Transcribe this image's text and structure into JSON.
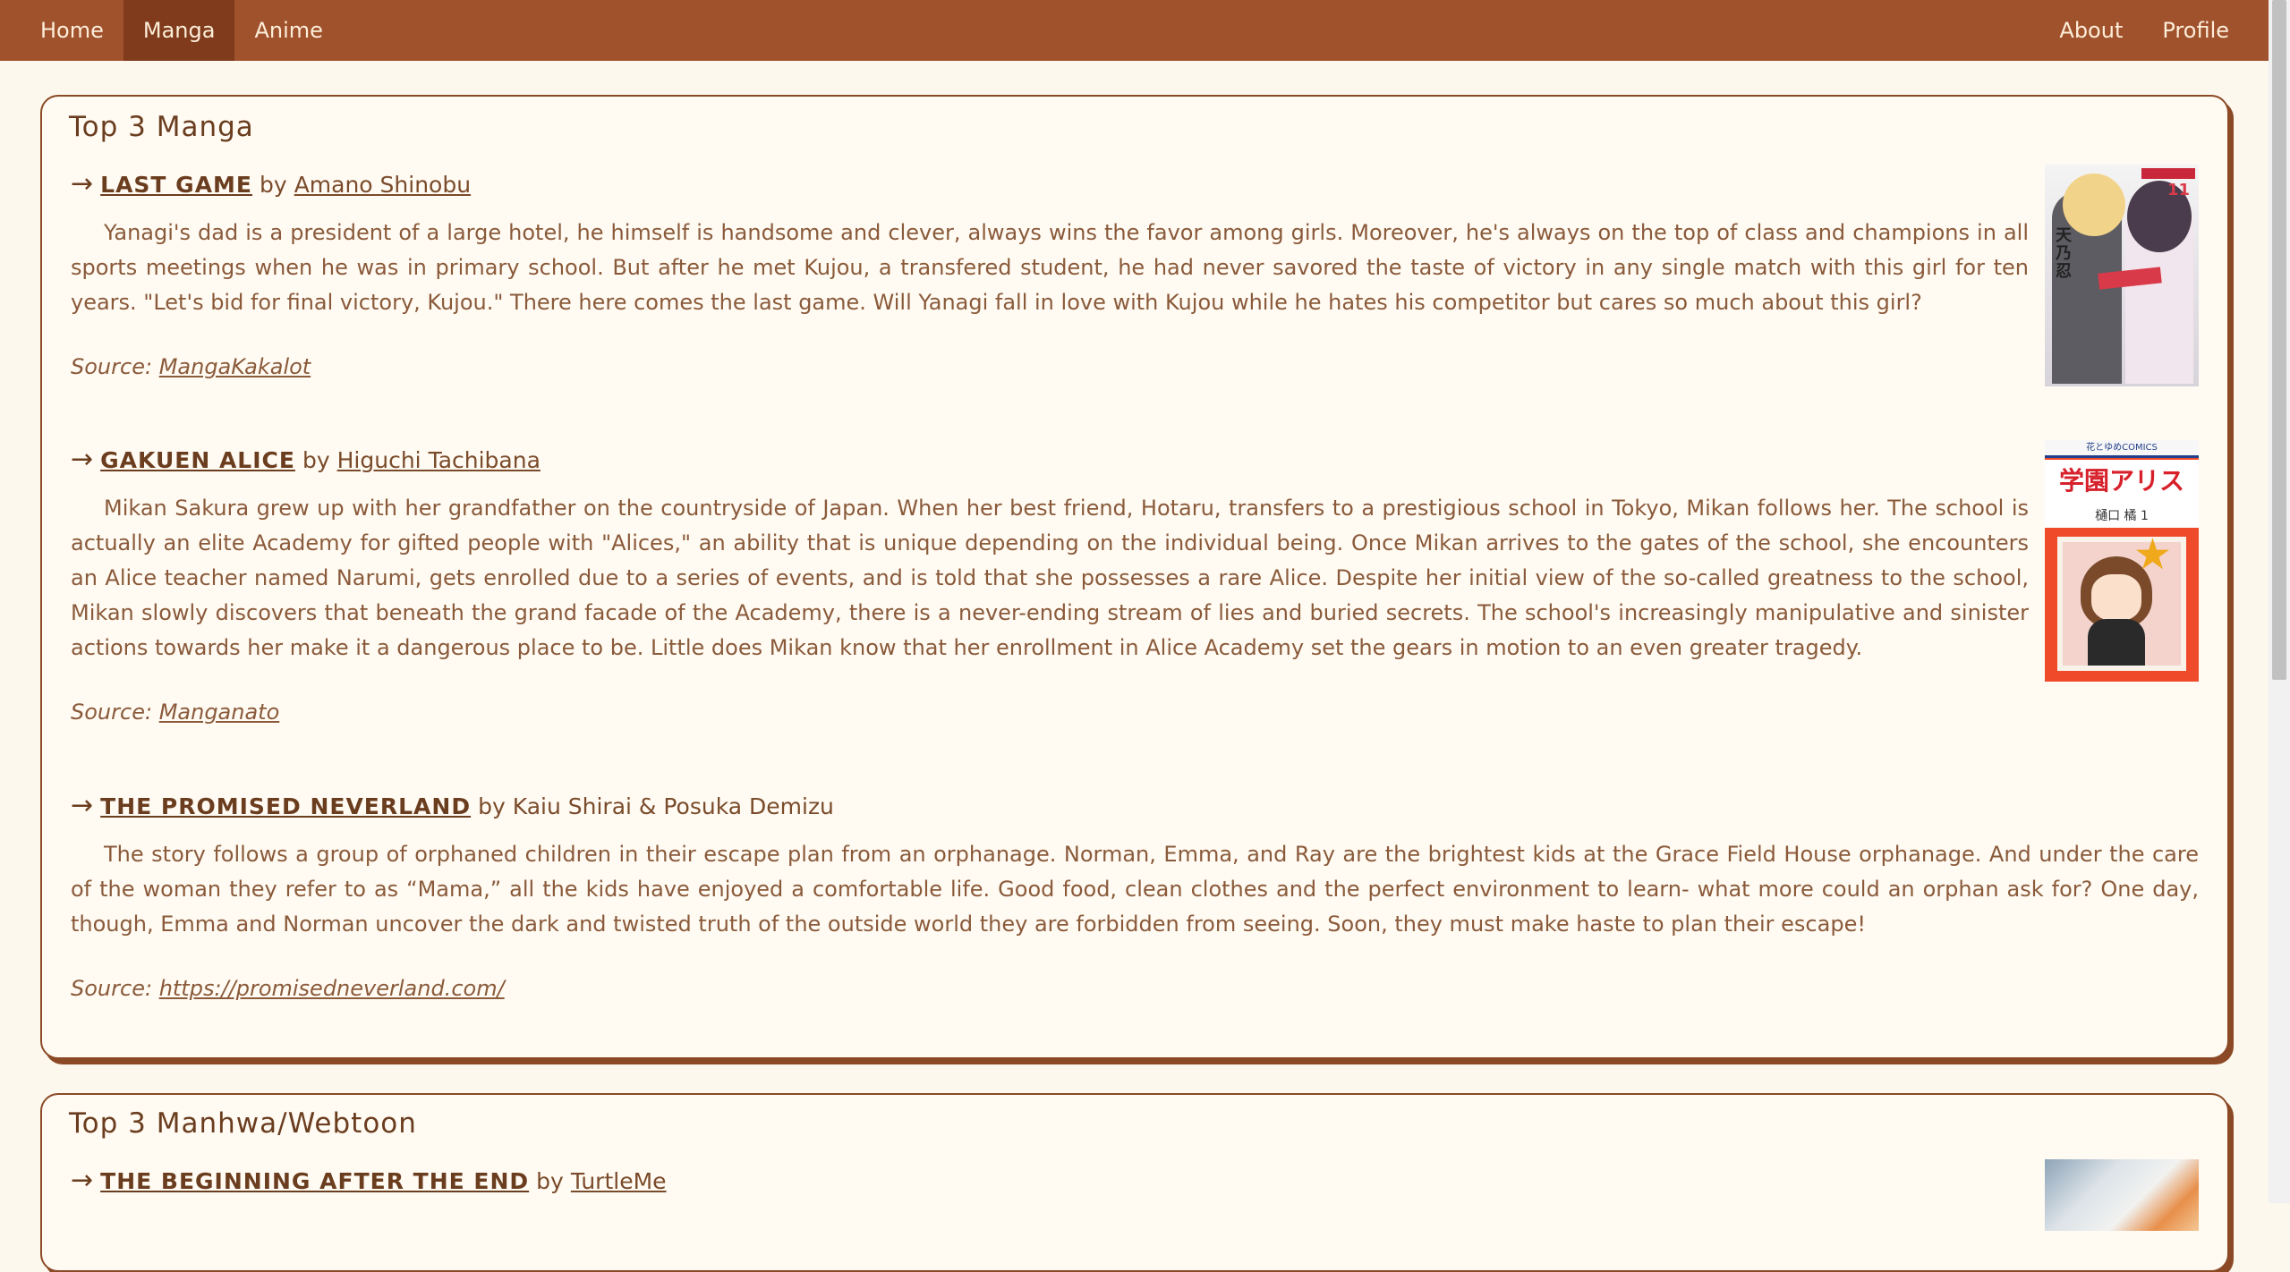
{
  "nav": {
    "left": [
      "Home",
      "Manga",
      "Anime"
    ],
    "active": "Manga",
    "right": [
      "About",
      "Profile"
    ]
  },
  "sections": [
    {
      "heading": "Top 3 Manga",
      "entries": [
        {
          "arrow": "→",
          "title": "LAST GAME",
          "by": "by",
          "author": "Amano Shinobu",
          "description": "Yanagi's dad is a president of a large hotel, he himself is handsome and clever, always wins the favor among girls. Moreover, he's always on the top of class and champions in all sports meetings when he was in primary school. But after he met Kujou, a transfered student, he had never savored the taste of victory in any single match with this girl for ten years. \"Let's bid for final victory, Kujou.\" There here comes the last game. Will Yanagi fall in love with Kujou while he hates his competitor but cares so much about this girl?",
          "source_label": "Source:",
          "source": "MangaKakalot",
          "cover": {
            "text": "天乃忍",
            "num": "11"
          }
        },
        {
          "arrow": "→",
          "title": "GAKUEN ALICE",
          "by": "by",
          "author": "Higuchi Tachibana",
          "description": "Mikan Sakura grew up with her grandfather on the countryside of Japan. When her best friend, Hotaru, transfers to a prestigious school in Tokyo, Mikan follows her. The school is actually an elite Academy for gifted people with \"Alices,\" an ability that is unique depending on the individual being. Once Mikan arrives to the gates of the school, she encounters an Alice teacher named Narumi, gets enrolled due to a series of events, and is told that she possesses a rare Alice. Despite her initial view of the so-called greatness to the school, Mikan slowly discovers that beneath the grand facade of the Academy, there is a never-ending stream of lies and buried secrets. The school's increasingly manipulative and sinister actions towards her make it a dangerous place to be. Little does Mikan know that her enrollment in Alice Academy set the gears in motion to an even greater tragedy.",
          "source_label": "Source:",
          "source": "Manganato",
          "cover": {
            "title": "学園アリス",
            "sub": "樋口 橘     1",
            "top": "花とゆめCOMICS"
          }
        },
        {
          "arrow": "→",
          "title": "THE PROMISED NEVERLAND",
          "by": "by",
          "author": "Kaiu Shirai & Posuka Demizu",
          "description": "The story follows a group of orphaned children in their escape plan from an orphanage. Norman, Emma, and Ray are the brightest kids at the Grace Field House orphanage. And under the care of the woman they refer to as “Mama,” all the kids have enjoyed a comfortable life. Good food, clean clothes and the perfect environment to learn- what more could an orphan ask for? One day, though, Emma and Norman uncover the dark and twisted truth of the outside world they are forbidden from seeing. Soon, they must make haste to plan their escape!",
          "source_label": "Source:",
          "source": "https://promisedneverland.com/"
        }
      ]
    },
    {
      "heading": "Top 3 Manhwa/Webtoon",
      "entries": [
        {
          "arrow": "→",
          "title": "THE BEGINNING AFTER THE END",
          "by": "by",
          "author": "TurtleMe"
        }
      ]
    }
  ],
  "colors": {
    "nav_bg": "#a0522d",
    "nav_active": "#7f3b1b",
    "page_bg": "#fdf8ee",
    "card_border": "#8b4a25",
    "text": "#7a4b2a"
  }
}
